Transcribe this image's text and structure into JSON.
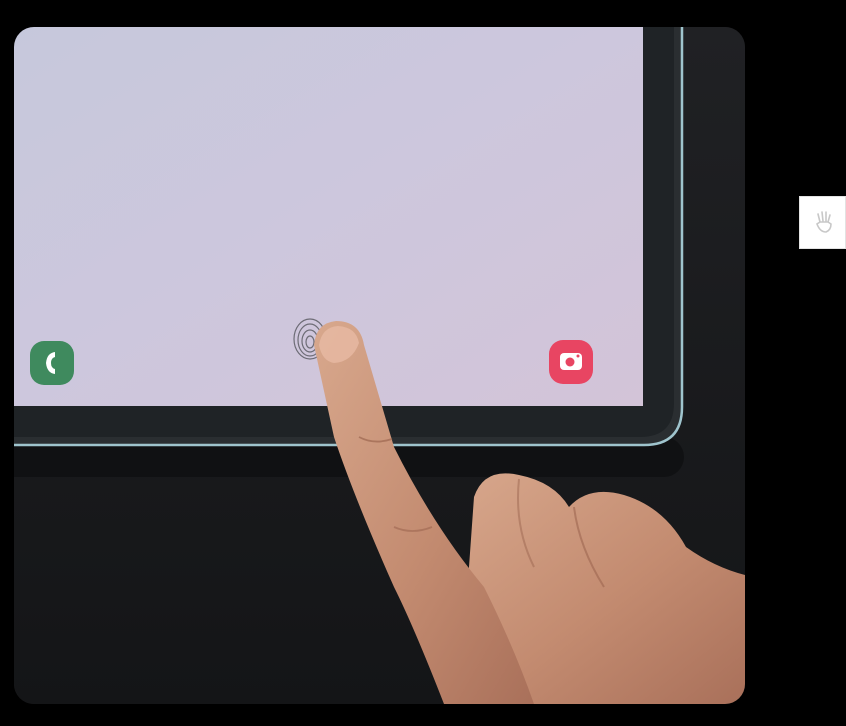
{
  "scene": {
    "subject": "finger-on-tablet-fingerprint-sensor",
    "icons": {
      "left_app": "phone-icon",
      "center": "fingerprint-icon",
      "right_app": "camera-icon",
      "side_thumb": "hand-icon"
    },
    "colors": {
      "page_background": "#000000",
      "screen_top": "#c9c8dd",
      "screen_bottom": "#cfc6da",
      "bezel": "#1f2326",
      "frame_edge": "#9fc4cd",
      "phone_app": "#3f8a5e",
      "camera_app": "#e84562",
      "skin": "#c9937a",
      "table": "#17181a",
      "thumb_background": "#ffffff"
    }
  }
}
